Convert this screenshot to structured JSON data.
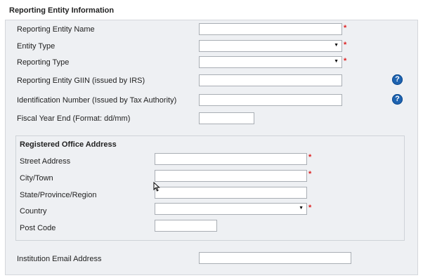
{
  "section": {
    "title": "Reporting Entity Information"
  },
  "fields": {
    "entity_name": {
      "label": "Reporting Entity Name",
      "value": ""
    },
    "entity_type": {
      "label": "Entity Type",
      "value": ""
    },
    "reporting_type": {
      "label": "Reporting Type",
      "value": ""
    },
    "giin": {
      "label": "Reporting Entity GIIN (issued by IRS)",
      "value": ""
    },
    "id_number": {
      "label": "Identification Number (Issued by Tax Authority)",
      "value": ""
    },
    "fiscal_year_end": {
      "label": "Fiscal Year End (Format: dd/mm)",
      "value": ""
    },
    "email": {
      "label": "Institution Email Address",
      "value": ""
    }
  },
  "address": {
    "title": "Registered Office Address",
    "street": {
      "label": "Street Address",
      "value": ""
    },
    "city": {
      "label": "City/Town",
      "value": ""
    },
    "state": {
      "label": "State/Province/Region",
      "value": ""
    },
    "country": {
      "label": "Country",
      "value": ""
    },
    "post_code": {
      "label": "Post Code",
      "value": ""
    }
  },
  "required_mark": "*",
  "help_glyph": "?",
  "colors": {
    "required": "#dd2222",
    "help": "#1e63b0",
    "panel": "#eef0f3"
  }
}
